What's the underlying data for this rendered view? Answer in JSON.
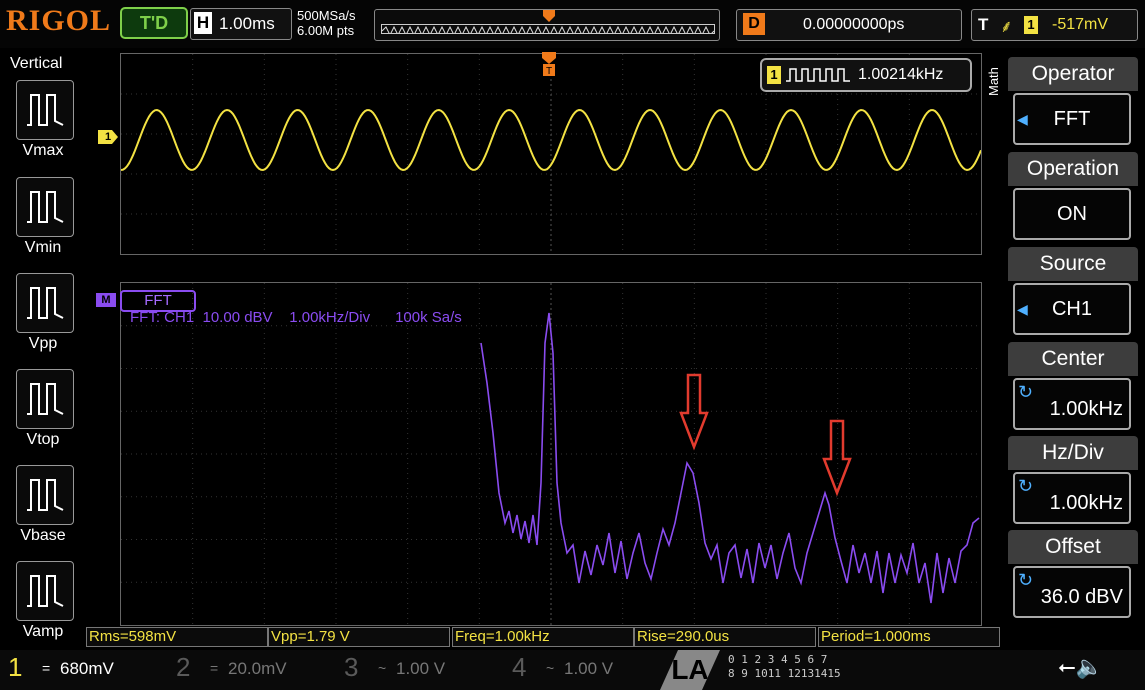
{
  "header": {
    "brand": "RIGOL",
    "run_status": "T'D",
    "timebase_tag": "H",
    "timebase": "1.00ms",
    "sample_rate": "500MSa/s",
    "memory_depth": "6.00M pts",
    "delay_tag": "D",
    "delay": "0.00000000ps",
    "trigger_tag": "T",
    "trigger_edge": "rising-edge-icon",
    "trigger_source": "1",
    "trigger_level": "-517mV"
  },
  "left_panel": {
    "title": "Vertical",
    "items": [
      {
        "label": "Vmax",
        "icon": "vmax-icon"
      },
      {
        "label": "Vmin",
        "icon": "vmin-icon"
      },
      {
        "label": "Vpp",
        "icon": "vpp-icon"
      },
      {
        "label": "Vtop",
        "icon": "vtop-icon"
      },
      {
        "label": "Vbase",
        "icon": "vbase-icon"
      },
      {
        "label": "Vamp",
        "icon": "vamp-icon"
      }
    ]
  },
  "waveform": {
    "channel_marker": "1",
    "counter_source": "1",
    "counter_value": "1.00214kHz",
    "color": "#f3e243"
  },
  "fft": {
    "tag": "FFT",
    "marker": "M",
    "info": "FFT: CH1  10.00 dBV    1.00kHz/Div      100k Sa/s",
    "color": "#8a4cf0",
    "annotation_color": "#e23b2e"
  },
  "menu": {
    "side_label": "Math",
    "items": [
      {
        "head": "Operator",
        "value": "FFT"
      },
      {
        "head": "Operation",
        "value": "ON"
      },
      {
        "head": "Source",
        "value": "CH1"
      },
      {
        "head": "Center",
        "value": "1.00kHz"
      },
      {
        "head": "Hz/Div",
        "value": "1.00kHz"
      },
      {
        "head": "Offset",
        "value": "36.0 dBV"
      }
    ]
  },
  "measurements": [
    "Rms=598mV",
    "Vpp=1.79 V",
    "Freq=1.00kHz",
    "Rise=290.0us",
    "Period=1.000ms"
  ],
  "channels": [
    {
      "num": "1",
      "coupling": "=",
      "scale": "680mV",
      "color": "#f3e243"
    },
    {
      "num": "2",
      "coupling": "=",
      "scale": "20.0mV",
      "color": "#5a5a5a"
    },
    {
      "num": "3",
      "coupling": "~",
      "scale": "1.00 V",
      "color": "#5a5a5a"
    },
    {
      "num": "4",
      "coupling": "~",
      "scale": "1.00 V",
      "color": "#5a5a5a"
    }
  ],
  "la": {
    "label": "LA",
    "row1": "0 1 2 3  4 5 6 7",
    "row2": "8 9 1011 12131415"
  }
}
